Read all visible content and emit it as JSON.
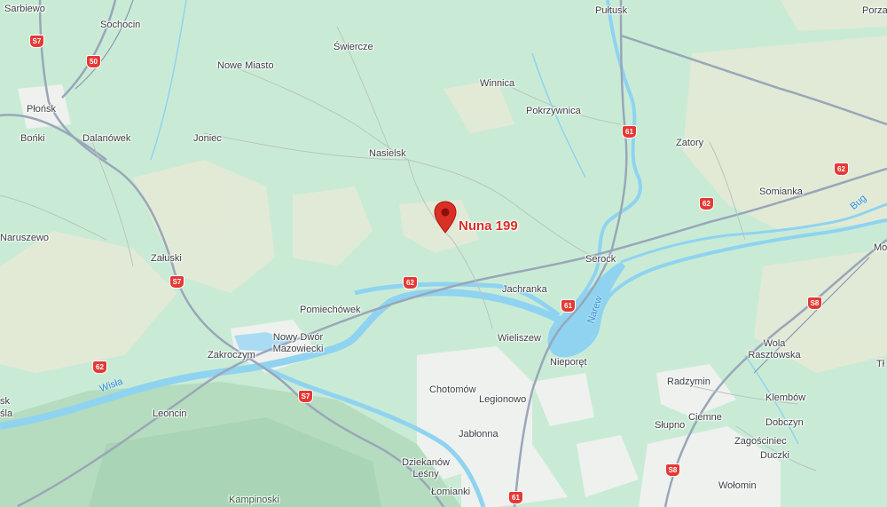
{
  "map": {
    "marker": {
      "label": "Nuna 199",
      "color": "#d93025"
    },
    "places": {
      "sarbiewo": "Sarbiewo",
      "sochocin": "Sochocin",
      "pultusk": "Pułtusk",
      "porza": "Porza",
      "nowe_miasto": "Nowe Miasto",
      "swiercze": "Świercze",
      "winnica": "Winnica",
      "plonsk": "Płońsk",
      "bonki": "Bońki",
      "dalanowek": "Dalanówek",
      "joniec": "Joniec",
      "pokrzywnica": "Pokrzywnica",
      "zatory": "Zatory",
      "nasielsk": "Nasielsk",
      "somianka": "Somianka",
      "naruszewo": "Naruszewo",
      "mo": "Mo",
      "serock": "Serock",
      "zaluski": "Załuski",
      "jachranka": "Jachranka",
      "pomiechowek": "Pomiechówek",
      "nowy_dwor": "Nowy Dwór",
      "mazowiecki": "Mazowiecki",
      "wieliszew": "Wieliszew",
      "wola": "Wola",
      "rasztowska": "Rasztowska",
      "zakroczym": "Zakroczym",
      "nieporet": "Nieporęt",
      "tl": "Tł",
      "radzymin": "Radzymin",
      "chotomow": "Chotomów",
      "sk": "sk",
      "legionowo": "Legionowo",
      "klembow": "Klembów",
      "sla": "śla",
      "ciemne": "Ciemne",
      "leoncin": "Leoncin",
      "dobczyn": "Dobczyn",
      "slupno": "Słupno",
      "jablonna": "Jabłonna",
      "zagosciniec": "Zagościniec",
      "duczki": "Duczki",
      "dziekanow": "Dziekanów",
      "lesny": "Leśny",
      "lomianki": "Łomianki",
      "wolomin": "Wołomin",
      "kampinoski": "Kampinoski"
    },
    "rivers": {
      "wisla": "Wisła",
      "narew": "Narew",
      "bug": "Bug"
    },
    "roads": {
      "s7": "S7",
      "r50": "50",
      "r61": "61",
      "r62": "62",
      "s8": "S8"
    },
    "colors": {
      "land": "#c9ebd6",
      "farmland": "#e6ead8",
      "forest": "#b9dfc3",
      "water": "#8fd3f0",
      "urban": "#eef1ee",
      "road": "#9aa6b8",
      "shield": "#e53935"
    }
  }
}
